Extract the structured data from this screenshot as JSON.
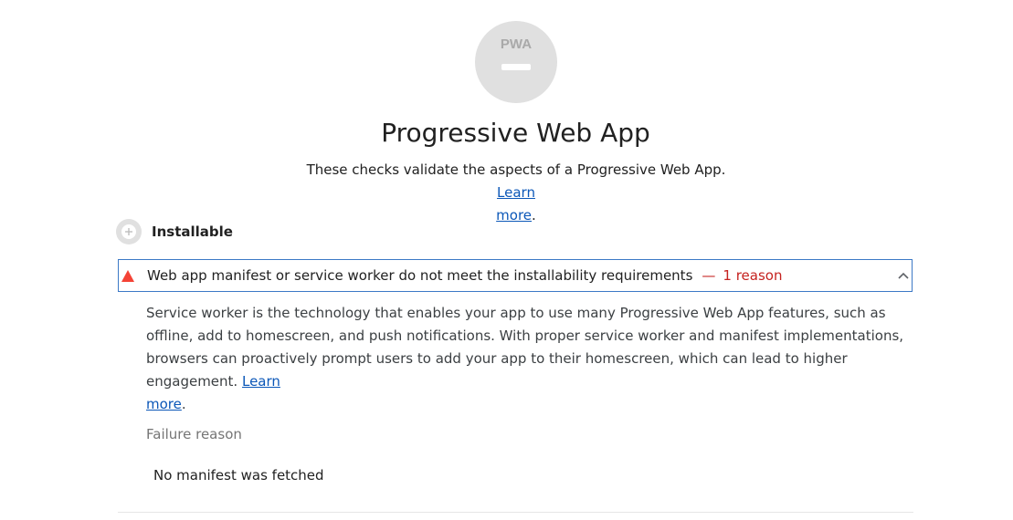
{
  "category": {
    "logo_text": "PWA",
    "title": "Progressive Web App",
    "description": "These checks validate the aspects of a Progressive Web App.",
    "learn_more_label_1": "Learn",
    "learn_more_label_2": "more",
    "description_end": "."
  },
  "group": {
    "title": "Installable",
    "icon": "plus-circle-icon"
  },
  "audit": {
    "status_icon": "fail-triangle-icon",
    "title": "Web app manifest or service worker do not meet the installability requirements",
    "separator": "—",
    "reason_count": "1 reason",
    "expanded_icon": "chevron-up-icon",
    "description": "Service worker is the technology that enables your app to use many Progressive Web App features, such as offline, add to homescreen, and push notifications. With proper service worker and manifest implementations, browsers can proactively prompt users to add your app to their homescreen, which can lead to higher engagement.",
    "learn_more_label_1": "Learn",
    "learn_more_label_2": "more",
    "description_end": ".",
    "failure_header": "Failure reason",
    "failure_value": "No manifest was fetched"
  },
  "colors": {
    "gauge_bg": "#e0e0e0",
    "fail": "#c5221f",
    "fail_icon": "#f44336",
    "link": "#0b57b8",
    "focus_border": "#3c79c6"
  }
}
